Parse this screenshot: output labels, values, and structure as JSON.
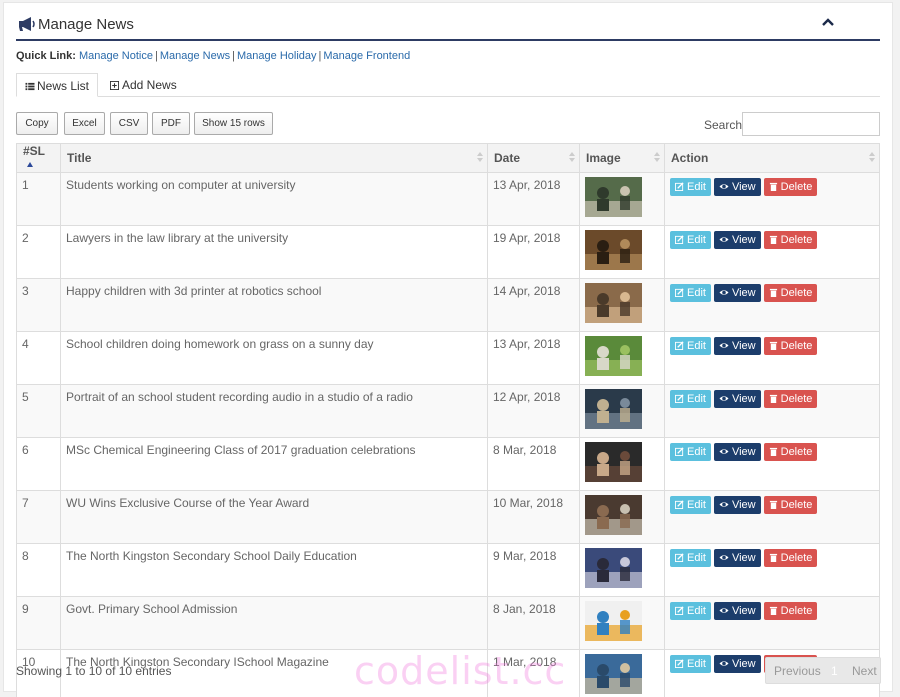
{
  "header": {
    "title": "Manage News"
  },
  "quick_links": {
    "label": "Quick Link:",
    "items": [
      "Manage Notice",
      "Manage News",
      "Manage Holiday",
      "Manage Frontend"
    ]
  },
  "tabs": [
    {
      "label": "News List",
      "active": true
    },
    {
      "label": "Add News",
      "active": false
    }
  ],
  "export_buttons": [
    "Copy",
    "Excel",
    "CSV",
    "PDF",
    "Show 15 rows"
  ],
  "search": {
    "label": "Search:",
    "value": ""
  },
  "table": {
    "columns": [
      "#SL",
      "Title",
      "Date",
      "Image",
      "Action"
    ],
    "rows": [
      {
        "sl": "1",
        "title": "Students working on computer at university",
        "date": "13 Apr, 2018",
        "image": "students-computer"
      },
      {
        "sl": "2",
        "title": "Lawyers in the law library at the university",
        "date": "19 Apr, 2018",
        "image": "law-library"
      },
      {
        "sl": "3",
        "title": "Happy children with 3d printer at robotics school",
        "date": "14 Apr, 2018",
        "image": "children-3d-printer"
      },
      {
        "sl": "4",
        "title": "School children doing homework on grass on a sunny day",
        "date": "13 Apr, 2018",
        "image": "children-grass"
      },
      {
        "sl": "5",
        "title": "Portrait of an school student recording audio in a studio of a radio",
        "date": "12 Apr, 2018",
        "image": "student-studio"
      },
      {
        "sl": "6",
        "title": "MSc Chemical Engineering Class of 2017 graduation celebrations",
        "date": "8 Mar, 2018",
        "image": "graduation"
      },
      {
        "sl": "7",
        "title": "WU Wins Exclusive Course of the Year Award",
        "date": "10 Mar, 2018",
        "image": "award"
      },
      {
        "sl": "8",
        "title": "The North Kingston Secondary School Daily Education",
        "date": "9 Mar, 2018",
        "image": "daily-education"
      },
      {
        "sl": "9",
        "title": "Govt. Primary School Admission",
        "date": "8 Jan, 2018",
        "image": "admission-open"
      },
      {
        "sl": "10",
        "title": "The North Kingston Secondary ISchool Magazine",
        "date": "1 Mar, 2018",
        "image": "school-magazine"
      }
    ],
    "actions": {
      "edit": "Edit",
      "view": "View",
      "delete": "Delete"
    }
  },
  "footer": {
    "info": "Showing 1 to 10 of 10 entries",
    "pagination": {
      "previous": "Previous",
      "current": "1",
      "next": "Next"
    }
  },
  "watermark": "codelist.cc",
  "colors": {
    "header_rule": "#2d3b63",
    "link": "#2a6aaa",
    "edit": "#5bc0de",
    "view": "#1c3d6b",
    "delete": "#d9534f"
  },
  "icons": [
    "megaphone-icon",
    "chevron-up-icon",
    "list-icon",
    "plus-square-icon",
    "edit-icon",
    "eye-icon",
    "trash-icon"
  ]
}
